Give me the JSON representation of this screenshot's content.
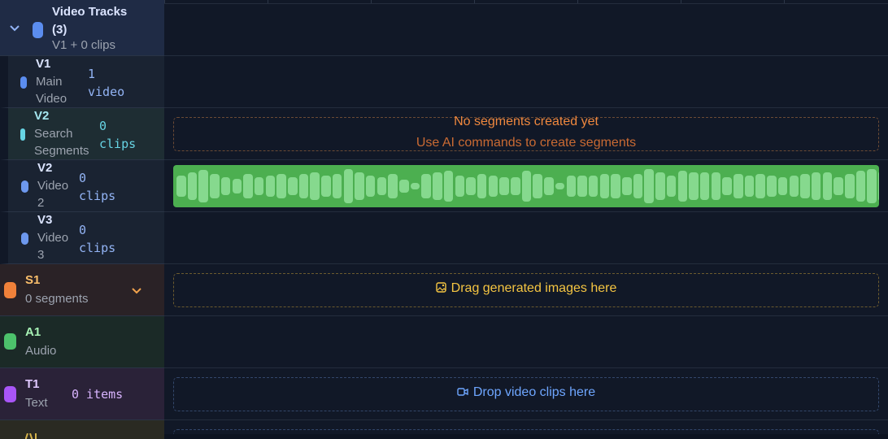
{
  "video_group": {
    "title": "Video Tracks (3)",
    "subtitle": "V1 + 0 clips"
  },
  "tracks": [
    {
      "id": "V1",
      "name": "Main Video",
      "count": "1 video"
    },
    {
      "id": "V2",
      "name": "Search Segments",
      "count": "0 clips"
    },
    {
      "id": "V2",
      "name": "Video 2",
      "count": "0 clips"
    },
    {
      "id": "V3",
      "name": "Video 3",
      "count": "0 clips"
    }
  ],
  "s1": {
    "id": "S1",
    "sub": "0 segments"
  },
  "a1": {
    "id": "A1",
    "sub": "Audio"
  },
  "t1": {
    "id": "T1",
    "sub": "Text",
    "count": "0 items"
  },
  "timeline": {
    "no_segments": "No segments created yet",
    "no_segments_hint": "Use AI commands to create segments",
    "drop_images": "Drag generated images here",
    "drop_clips": "Drop video clips here"
  },
  "colors": {
    "video_accent": "#5b8def",
    "search_accent": "#67d4e4",
    "segment_accent": "#f0813a",
    "audio_accent": "#4cc26b",
    "text_accent": "#a855f7",
    "waveform": "#4caf50"
  },
  "icons": {
    "collapse": "chevron-down-icon",
    "expand": "chevron-down-icon",
    "image": "image-icon",
    "video": "video-icon"
  }
}
